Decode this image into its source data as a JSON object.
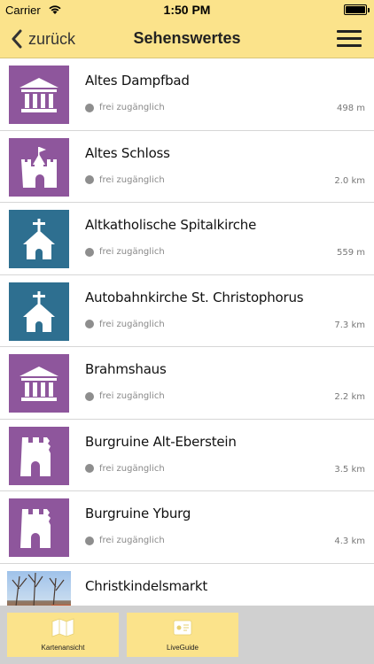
{
  "status_bar": {
    "carrier": "Carrier",
    "time": "1:50 PM"
  },
  "nav": {
    "back_label": "zurück",
    "title": "Sehenswertes"
  },
  "colors": {
    "accent": "#fbe38b",
    "museum": "#8e569c",
    "church": "#2e6f90"
  },
  "items": [
    {
      "title": "Altes Dampfbad",
      "access": "frei zugänglich",
      "distance": "498 m",
      "icon": "museum-icon"
    },
    {
      "title": "Altes Schloss",
      "access": "frei zugänglich",
      "distance": "2.0 km",
      "icon": "castle-icon"
    },
    {
      "title": "Altkatholische Spitalkirche",
      "access": "frei zugänglich",
      "distance": "559 m",
      "icon": "church-icon"
    },
    {
      "title": "Autobahnkirche St. Christophorus",
      "access": "frei zugänglich",
      "distance": "7.3 km",
      "icon": "church-icon"
    },
    {
      "title": "Brahmshaus",
      "access": "frei zugänglich",
      "distance": "2.2 km",
      "icon": "museum-icon"
    },
    {
      "title": "Burgruine Alt-Eberstein",
      "access": "frei zugänglich",
      "distance": "3.5 km",
      "icon": "ruin-icon"
    },
    {
      "title": "Burgruine Yburg",
      "access": "frei zugänglich",
      "distance": "4.3 km",
      "icon": "ruin-icon"
    },
    {
      "title": "Christkindelsmarkt",
      "icon": "photo"
    }
  ],
  "tabs": [
    {
      "label": "Kartenansicht",
      "icon": "map-icon"
    },
    {
      "label": "LiveGuide",
      "icon": "liveguide-icon"
    }
  ]
}
